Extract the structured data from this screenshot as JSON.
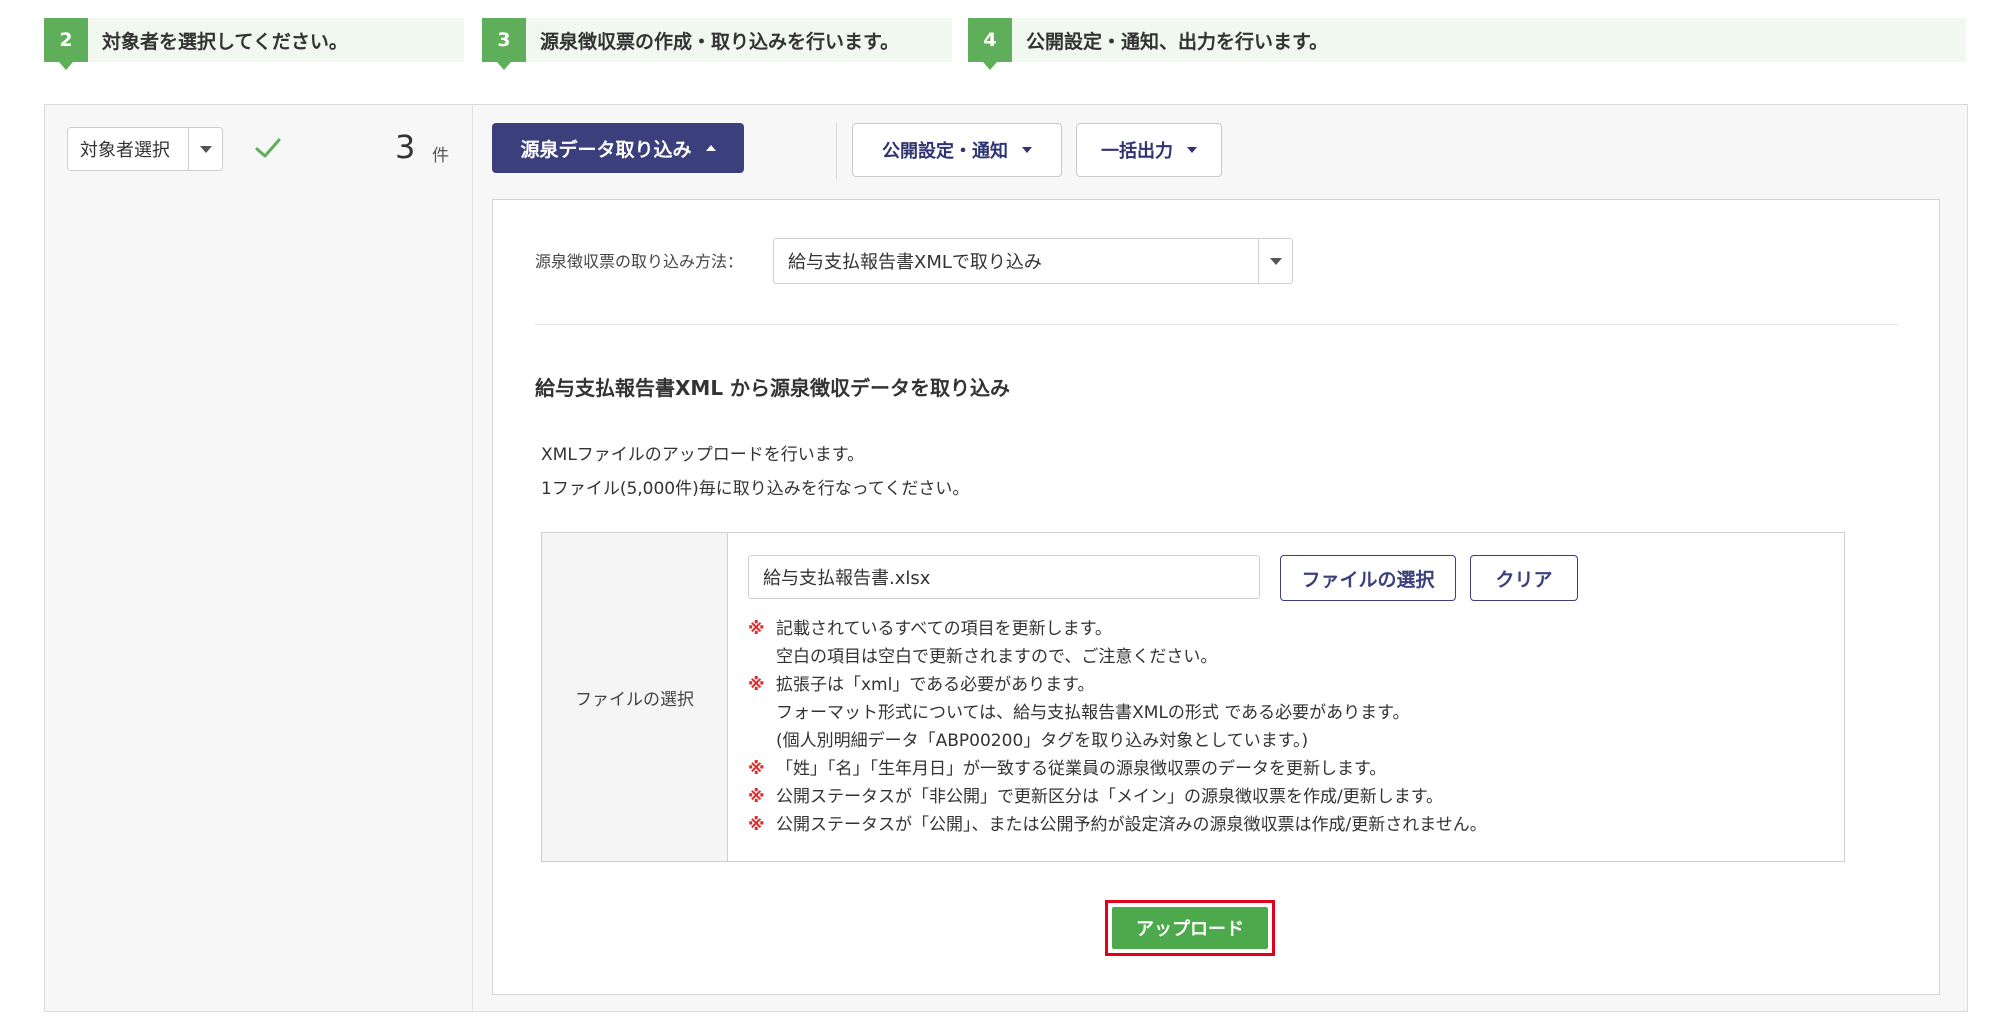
{
  "steps": [
    {
      "number": "2",
      "text": "対象者を選択してください。"
    },
    {
      "number": "3",
      "text": "源泉徴収票の作成・取り込みを行います。"
    },
    {
      "number": "4",
      "text": "公開設定・通知、出力を行います。"
    }
  ],
  "left_panel": {
    "target_select_label": "対象者選択",
    "check_icon": "check-icon",
    "count": "3",
    "count_unit": "件"
  },
  "toolbar": {
    "import_button": "源泉データ取り込み",
    "publish_button": "公開設定・通知",
    "export_button": "一括出力"
  },
  "import_panel": {
    "method_label": "源泉徴収票の取り込み方法：",
    "method_value": "給与支払報告書XMLで取り込み",
    "section_title": "給与支払報告書XML から源泉徴収データを取り込み",
    "description": [
      "XMLファイルのアップロードを行います。",
      "1ファイル(5,000件)毎に取り込みを行なってください。"
    ],
    "file_table": {
      "header": "ファイルの選択",
      "file_value": "給与支払報告書.xlsx",
      "select_button": "ファイルの選択",
      "clear_button": "クリア",
      "note_mark": "※",
      "notes": [
        {
          "mark": true,
          "text": "記載されているすべての項目を更新します。"
        },
        {
          "mark": false,
          "text": "空白の項目は空白で更新されますので、ご注意ください。"
        },
        {
          "mark": true,
          "text": "拡張子は「xml」である必要があります。"
        },
        {
          "mark": false,
          "text": "フォーマット形式については、給与支払報告書XMLの形式 である必要があります。"
        },
        {
          "mark": false,
          "text": "(個人別明細データ「ABP00200」タグを取り込み対象としています。)"
        },
        {
          "mark": true,
          "text": "「姓」「名」「生年月日」が一致する従業員の源泉徴収票のデータを更新します。"
        },
        {
          "mark": true,
          "text": "公開ステータスが「非公開」で更新区分は「メイン」の源泉徴収票を作成/更新します。"
        },
        {
          "mark": true,
          "text": "公開ステータスが「公開」、または公開予約が設定済みの源泉徴収票は作成/更新されません。"
        }
      ]
    },
    "upload_button": "アップロード"
  },
  "colors": {
    "step_green": "#5fae5a",
    "navy": "#3b3f7c",
    "upload_green": "#4caa4c",
    "highlight_red": "#e4001b",
    "note_red": "#e12b2b"
  }
}
